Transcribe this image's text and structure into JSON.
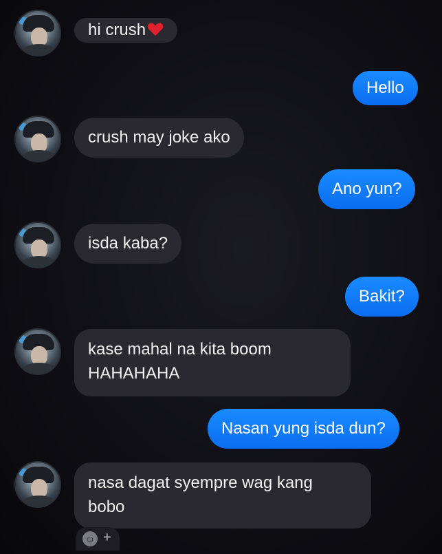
{
  "messages": [
    {
      "from": "them",
      "text": "hi crush",
      "trailing": "heart"
    },
    {
      "from": "me",
      "text": "Hello"
    },
    {
      "from": "them",
      "text": "crush may joke ako"
    },
    {
      "from": "me",
      "text": "Ano yun?"
    },
    {
      "from": "them",
      "text": "isda kaba?"
    },
    {
      "from": "me",
      "text": "Bakit?"
    },
    {
      "from": "them",
      "line1": "kase mahal na kita boom",
      "line2": "HAHAHAHA"
    },
    {
      "from": "me",
      "text": "Nasan yung isda dun?"
    },
    {
      "from": "them",
      "line1": "nasa dagat syempre wag kang",
      "line2": "bobo"
    }
  ],
  "colors": {
    "outgoing": "#0a6df0",
    "incoming": "#2a2930",
    "heart": "#e0202c"
  },
  "composer": {
    "icons": [
      "emoji-icon",
      "plus-icon"
    ]
  }
}
